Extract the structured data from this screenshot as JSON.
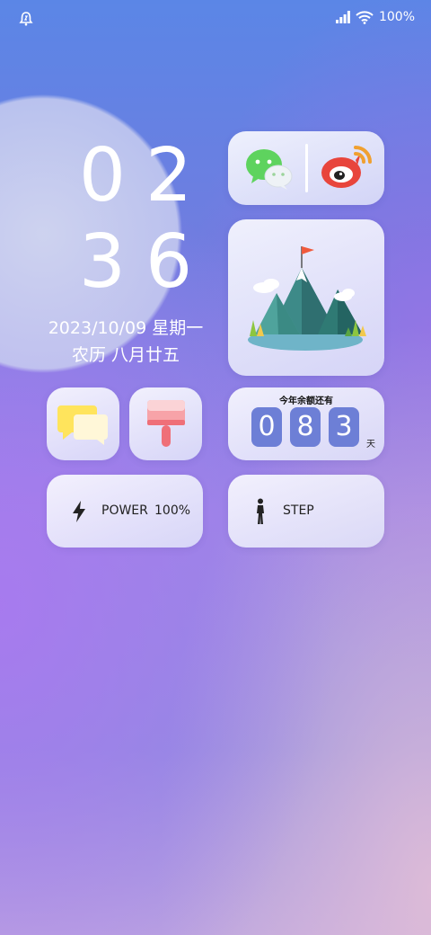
{
  "status_bar": {
    "battery_label": "100%",
    "icons": [
      "notification-bell-icon",
      "signal-icon",
      "wifi-icon"
    ]
  },
  "clock": {
    "hour": "02",
    "minute": "36"
  },
  "date": {
    "line1": "2023/10/09 星期一",
    "line2": "农历 八月廿五"
  },
  "apps_widget": {
    "icons": [
      "wechat-icon",
      "weibo-icon"
    ]
  },
  "photo_widget": {
    "icon": "mountain-illustration"
  },
  "shortcuts": {
    "icons": [
      "sticky-note-icon",
      "cleaner-brush-icon"
    ]
  },
  "days_remaining": {
    "title": "今年余额还有",
    "digits": [
      "0",
      "8",
      "3"
    ],
    "unit": "天"
  },
  "power_widget": {
    "label": "POWER",
    "value": "100%",
    "icon": "lightning-icon"
  },
  "step_widget": {
    "label": "STEP",
    "icon": "walking-person-icon"
  },
  "colors": {
    "digit_bg": "#6d7fd6",
    "card_bg": "#eef0fb",
    "wechat": "#5ed35e",
    "weibo": "#e8453c"
  }
}
